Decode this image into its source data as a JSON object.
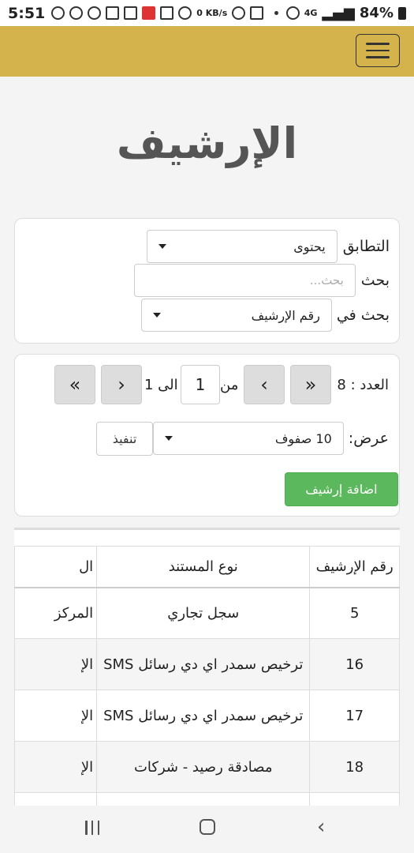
{
  "status_bar": {
    "time": "5:51",
    "network": "4G",
    "speed_value": "0",
    "speed_unit": "KB/s",
    "battery": "84%"
  },
  "page": {
    "title": "الإرشيف"
  },
  "search": {
    "match_label": "التطابق",
    "match_value": "يحتوى",
    "search_label": "بحث",
    "search_placeholder": "بحث...",
    "search_in_label": "بحث في",
    "search_in_value": "رقم الإرشيف"
  },
  "pagination": {
    "count_label": "العدد : 8",
    "from_label": "من",
    "current_page": "1",
    "to_label": "الى 1",
    "first_glyph": "«",
    "prev_glyph": "‹",
    "next_glyph": "›",
    "last_glyph": "»",
    "display_label": "عرض:",
    "rows_value": "10 صفوف",
    "execute_label": "تنفيذ",
    "add_label": "اضافة إرشيف"
  },
  "table": {
    "headers": [
      "رقم الإرشيف",
      "نوع المستند",
      "ال"
    ],
    "rows": [
      [
        "5",
        "سجل تجاري",
        "المركز"
      ],
      [
        "16",
        "ترخيص سمدر اي دي رسائل SMS",
        "الإ"
      ],
      [
        "17",
        "ترخيص سمدر اي دي رسائل SMS",
        "الإ"
      ],
      [
        "18",
        "مصادقة رصيد - شركات",
        "الإ"
      ]
    ]
  },
  "colors": {
    "navbar": "#d4b24c",
    "add_button": "#5cb85c"
  }
}
